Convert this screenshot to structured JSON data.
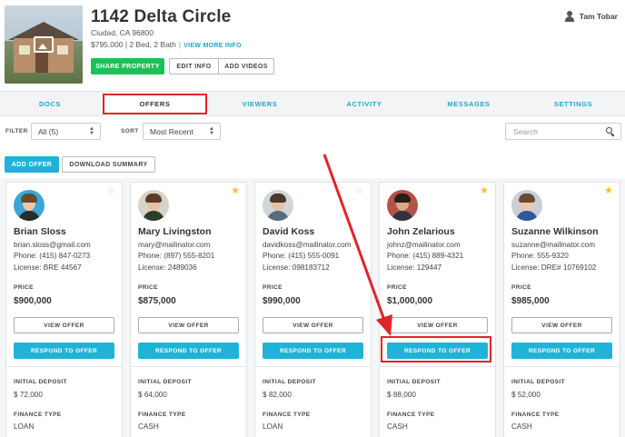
{
  "property": {
    "title": "1142 Delta Circle",
    "address": "Ciudad, CA 96800",
    "specs": "$795,000 | 2 Bed, 2 Bath",
    "view_more": "VIEW MORE INFO"
  },
  "header_buttons": {
    "share": "SHARE PROPERTY",
    "edit": "EDIT INFO",
    "videos": "ADD VIDEOS"
  },
  "user": {
    "name": "Tam Tobar",
    "icon": "user-icon"
  },
  "tabs": [
    {
      "label": "DOCS",
      "active": false
    },
    {
      "label": "OFFERS",
      "active": true
    },
    {
      "label": "VIEWERS",
      "active": false
    },
    {
      "label": "ACTIVITY",
      "active": false
    },
    {
      "label": "MESSAGES",
      "active": false
    },
    {
      "label": "SETTINGS",
      "active": false
    }
  ],
  "filters": {
    "filter_label": "FILTER",
    "filter_value": "All (5)",
    "sort_label": "SORT",
    "sort_value": "Most Recent",
    "search_placeholder": "Search"
  },
  "actions": {
    "add_offer": "ADD OFFER",
    "download_summary": "DOWNLOAD SUMMARY"
  },
  "card_labels": {
    "price": "PRICE",
    "view_offer": "VIEW OFFER",
    "respond": "RESPOND TO OFFER",
    "initial_deposit": "INITIAL DEPOSIT",
    "finance_type": "FINANCE TYPE"
  },
  "offers": [
    {
      "name": "Brian Sloss",
      "email": "brian.sloss@gmail.com",
      "phone": "Phone: (415) 847-0273",
      "license": "License: BRE 44567",
      "price": "$900,000",
      "deposit": "$ 72,000",
      "finance": "LOAN",
      "starred": false
    },
    {
      "name": "Mary Livingston",
      "email": "mary@mailinator.com",
      "phone": "Phone: (897) 555-8201",
      "license": "License: 2489036",
      "price": "$875,000",
      "deposit": "$ 64,000",
      "finance": "CASH",
      "starred": true
    },
    {
      "name": "David Koss",
      "email": "davidkoss@mailinator.com",
      "phone": "Phone: (415) 555-0091",
      "license": "License: 098183712",
      "price": "$990,000",
      "deposit": "$ 82,000",
      "finance": "LOAN",
      "starred": false
    },
    {
      "name": "John Zelarious",
      "email": "johnz@mailinator.com",
      "phone": "Phone: (415) 889-4321",
      "license": "License: 129447",
      "price": "$1,000,000",
      "deposit": "$ 88,000",
      "finance": "CASH",
      "starred": true
    },
    {
      "name": "Suzanne Wilkinson",
      "email": "suzanne@mailinator.com",
      "phone": "Phone: 555-9320",
      "license": "License: DRE# 10769102",
      "price": "$985,000",
      "deposit": "$ 52,000",
      "finance": "CASH",
      "starred": true
    }
  ],
  "colors": {
    "accent": "#20b3d8",
    "share_green": "#1ebf57",
    "highlight_red": "#e0242b",
    "star_gold": "#f5c518"
  }
}
